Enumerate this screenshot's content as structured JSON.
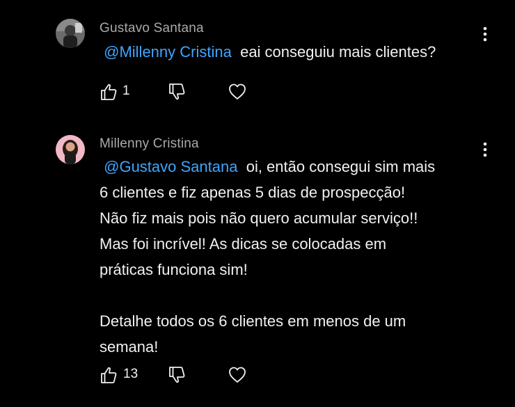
{
  "comments": [
    {
      "author": "Gustavo Santana",
      "mention": "@Millenny Cristina",
      "text": "eai conseguiu mais clientes?",
      "likes": "1",
      "avatar_icon": "avatar-photo-gustavo"
    },
    {
      "author": "Millenny Cristina",
      "mention": "@Gustavo Santana",
      "text_first_line": "oi, então consegui sim mais",
      "text_rest": "6 clientes e fiz apenas 5 dias de prospecção!\nNão fiz mais pois não quero acumular serviço!!\nMas foi incrível! As dicas se colocadas em\npráticas funciona sim!\n\nDetalhe todos os 6 clientes em menos de um\nsemana!",
      "likes": "13",
      "avatar_icon": "avatar-photo-millenny"
    }
  ],
  "icons": {
    "like": "thumbs-up-icon",
    "dislike": "thumbs-down-icon",
    "heart": "heart-icon",
    "menu": "more-vertical-icon"
  },
  "colors": {
    "background": "#000000",
    "mention": "#3ea6ff",
    "author": "#aaaaaa",
    "text": "#f1f1f1"
  }
}
